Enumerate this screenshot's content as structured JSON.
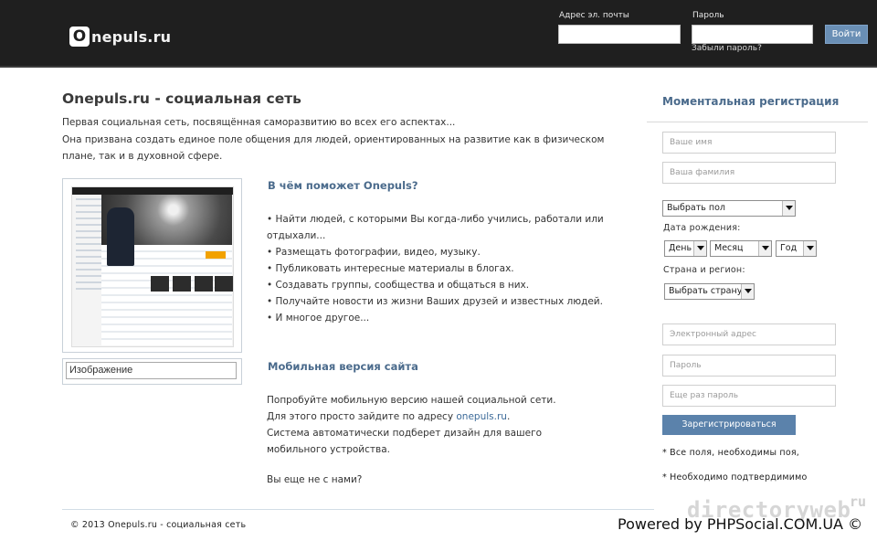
{
  "header": {
    "logo_mark": "O",
    "logo_text": "nepuls.ru",
    "email_label": "Адрес эл. почты",
    "password_label": "Пароль",
    "login_button": "Войти",
    "forgot_password": "Забыли пароль?"
  },
  "main": {
    "title": "Onepuls.ru - социальная сеть",
    "intro_line1": "Первая социальная сеть, посвящённая саморазвитию во всех его аспектах...",
    "intro_line2": "Она призвана создать единое поле общения для людей, ориентированных на развитие как в физическом плане, так и в духовной сфере.",
    "image_caption": "Изображение",
    "help_title": "В чём поможет Onepuls?",
    "help_items": [
      "Найти людей, с которыми Вы когда-либо учились, работали или отдыхали...",
      "Размещать фотографии, видео, музыку.",
      "Публиковать интересные материалы в блогах.",
      "Создавать группы, сообщества и общаться в них.",
      "Получайте новости из жизни Ваших друзей и известных людей.",
      "И многое другое..."
    ],
    "mobile_title": "Мобильная версия сайта",
    "mobile_line1": "Попробуйте мобильную версию нашей социальной сети.",
    "mobile_line2_prefix": "Для этого просто зайдите по адресу",
    "mobile_link": "onepuls.ru",
    "mobile_line2_suffix": ".",
    "mobile_line3": "Система автоматически подберет дизайн для вашего мобильного устройства.",
    "join_text": "Вы еще не с нами?"
  },
  "registration": {
    "title": "Моментальная регистрация",
    "first_name_placeholder": "Ваше имя",
    "last_name_placeholder": "Ваша фамилия",
    "gender_select": "Выбрать пол",
    "birthdate_label": "Дата рождения:",
    "day_select": "День",
    "month_select": "Месяц",
    "year_select": "Год",
    "country_label": "Страна и регион:",
    "country_select": "Выбрать страну",
    "email_placeholder": "Электронный адрес",
    "password_placeholder": "Пароль",
    "password_repeat_placeholder": "Еще раз пароль",
    "register_button": "Зарегистрироваться",
    "note1": "* Все поля, необходимы поя,",
    "note2": "* Необходимо подтвердимимо"
  },
  "footer": {
    "copyright": "© 2013 Onepuls.ru - социальная сеть",
    "powered": "Powered by PHPSocial.COM.UA ©",
    "watermark": "directoryweb",
    "watermark_suffix": "ru"
  }
}
